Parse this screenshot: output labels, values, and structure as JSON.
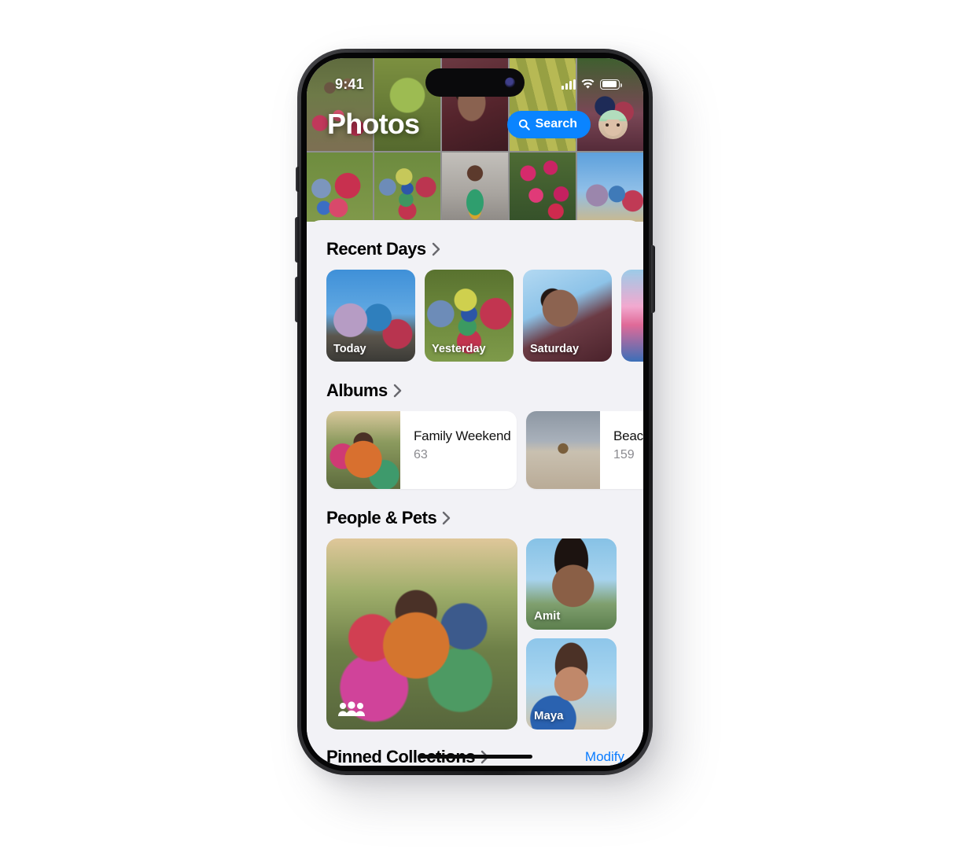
{
  "status_bar": {
    "time": "9:41",
    "cellular_icon": "signal-bars-icon",
    "wifi_icon": "wifi-icon",
    "battery_icon": "battery-icon"
  },
  "header": {
    "title": "Photos",
    "search_label": "Search",
    "search_icon": "search-icon",
    "avatar": "memoji-avatar",
    "accent_color": "#0A84FF"
  },
  "sections": {
    "recent_days": {
      "title": "Recent Days",
      "chevron_icon": "chevron-right-icon",
      "cards": [
        {
          "label": "Today"
        },
        {
          "label": "Yesterday"
        },
        {
          "label": "Saturday"
        },
        {
          "label": ""
        }
      ]
    },
    "albums": {
      "title": "Albums",
      "chevron_icon": "chevron-right-icon",
      "items": [
        {
          "name": "Family Weekend",
          "count": "63"
        },
        {
          "name": "Beach",
          "count": "159"
        }
      ]
    },
    "people_pets": {
      "title": "People & Pets",
      "chevron_icon": "chevron-right-icon",
      "group_icon": "group-people-icon",
      "people": [
        {
          "name": "Amit"
        },
        {
          "name": "Maya"
        }
      ]
    },
    "pinned_collections": {
      "title": "Pinned Collections",
      "chevron_icon": "chevron-right-icon",
      "modify_label": "Modify",
      "modify_color": "#0A7CFF"
    }
  }
}
